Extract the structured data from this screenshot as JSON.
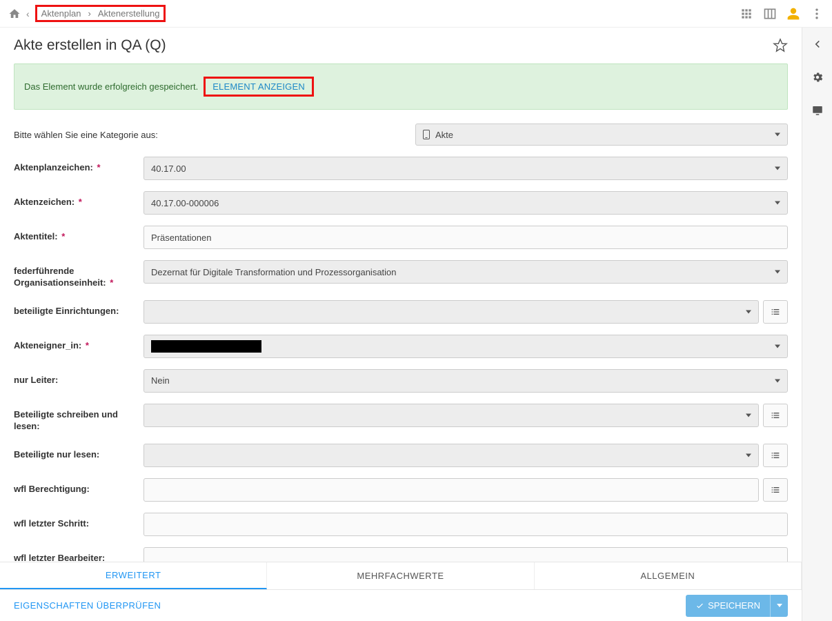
{
  "breadcrumb": {
    "item1": "Aktenplan",
    "item2": "Aktenerstellung"
  },
  "page_title": "Akte erstellen in QA (Q)",
  "alert": {
    "message": "Das Element wurde erfolgreich gespeichert.",
    "link": "ELEMENT ANZEIGEN"
  },
  "category": {
    "label": "Bitte wählen Sie eine Kategorie aus:",
    "value": "Akte"
  },
  "fields": {
    "aktenplanzeichen": {
      "label": "Aktenplanzeichen:",
      "value": "40.17.00",
      "required": true,
      "type": "select"
    },
    "aktenzeichen": {
      "label": "Aktenzeichen:",
      "value": "40.17.00-000006",
      "required": true,
      "type": "select"
    },
    "aktentitel": {
      "label": "Aktentitel:",
      "value": "Präsentationen",
      "required": true,
      "type": "text"
    },
    "federfuehrend": {
      "label": "federführende Organisationseinheit:",
      "value": "Dezernat für Digitale Transformation und Prozessorganisation",
      "required": true,
      "type": "select"
    },
    "beteiligte_einr": {
      "label": "beteiligte Einrichtungen:",
      "value": "",
      "required": false,
      "type": "select",
      "aux": true
    },
    "akteneigner": {
      "label": "Akteneigner_in:",
      "value": "",
      "required": true,
      "type": "select",
      "redacted": true
    },
    "nur_leiter": {
      "label": "nur Leiter:",
      "value": "Nein",
      "required": false,
      "type": "select"
    },
    "bet_schreiben": {
      "label": "Beteiligte schreiben und lesen:",
      "value": "",
      "required": false,
      "type": "select",
      "aux": true
    },
    "bet_lesen": {
      "label": "Beteiligte nur lesen:",
      "value": "",
      "required": false,
      "type": "select",
      "aux": true
    },
    "wfl_berechtigung": {
      "label": "wfl Berechtigung:",
      "value": "",
      "required": false,
      "type": "text",
      "aux": true
    },
    "wfl_letzter_schritt": {
      "label": "wfl letzter Schritt:",
      "value": "",
      "required": false,
      "type": "text"
    },
    "wfl_letzter_bearb": {
      "label": "wfl letzter Bearbeiter:",
      "value": "",
      "required": false,
      "type": "text"
    }
  },
  "tabs": {
    "t1": "ERWEITERT",
    "t2": "MEHRFACHWERTE",
    "t3": "ALLGEMEIN"
  },
  "footer": {
    "check": "EIGENSCHAFTEN ÜBERPRÜFEN",
    "save": "SPEICHERN"
  }
}
